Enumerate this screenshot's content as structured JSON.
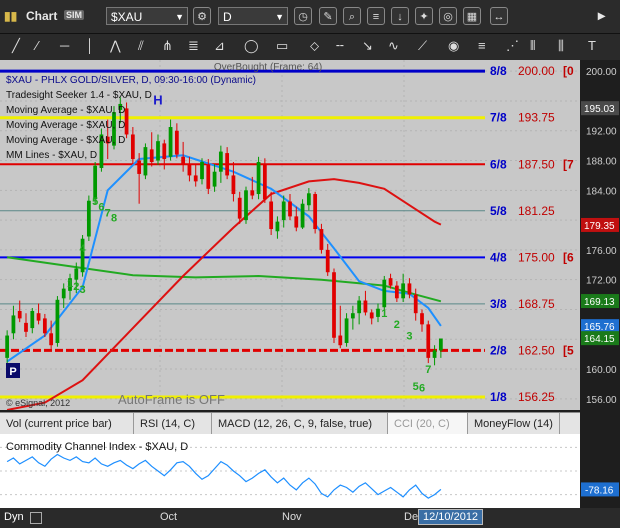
{
  "window": {
    "title": "Chart",
    "title_badge": "SIM",
    "symbol": "$XAU",
    "interval": "D"
  },
  "tabs": [
    {
      "label": "Vol (current price bar)"
    },
    {
      "label": "RSI (14, C)"
    },
    {
      "label": "MACD (12, 26, C, 9, false, true)"
    },
    {
      "label": "CCI (20, C)"
    },
    {
      "label": "MoneyFlow (14)"
    }
  ],
  "statusbar": {
    "left": "Dyn",
    "date_box": "12/10/2012"
  },
  "colors": {
    "background": "#c8c8c8",
    "candle_up": "#009900",
    "candle_down": "#e00000",
    "ma_short": "#1e90ff",
    "ma_long": "#dd1111",
    "ma_green": "#22aa22",
    "mm_8_8": "#0000c8",
    "mm_yellow": "#f0f000",
    "mm_red": "#e00000",
    "mm_teal": "#5a8888",
    "mm_blue": "#0000ee",
    "price_label_bg": "#0a2a6a",
    "last_price_label_bg": "#1a7a1a"
  },
  "chart_data": [
    {
      "type": "candlestick",
      "title": "$XAU - PHLX GOLD/SILVER, D, 09:30-16:00 (Dynamic)",
      "overlay_text": "OverBought (Frame: 64)",
      "legend": [
        "$XAU - PHLX GOLD/SILVER, D, 09:30-16:00 (Dynamic)",
        "Tradesight Seeker 1.4 - $XAU, D",
        "Moving Average - $XAU, D",
        "Moving Average - $XAU, D",
        "Moving Average - $XAU, D",
        "MM Lines - $XAU, D"
      ],
      "x_tick_labels": [
        "Oct",
        "Nov",
        "Dec"
      ],
      "y_range": [
        154.5,
        201.5
      ],
      "y_ticks": [
        156,
        160,
        164,
        168,
        172,
        176,
        180,
        184,
        188,
        192,
        196,
        200
      ],
      "right_price_labels": [
        "200.00",
        "195.03",
        "192.00",
        "188.00",
        "184.00",
        "179.35",
        "176.00",
        "172.00",
        "169.13",
        "165.76",
        "164.15",
        "160.00",
        "156.00"
      ],
      "last_price": 164.15,
      "ohlc": [
        [
          161.5,
          165.2,
          160.8,
          164.5
        ],
        [
          164.8,
          168.5,
          164.0,
          167.2
        ],
        [
          167.8,
          169.2,
          166.3,
          166.8
        ],
        [
          166.2,
          167.5,
          164.3,
          165.0
        ],
        [
          165.5,
          168.2,
          164.8,
          167.8
        ],
        [
          167.5,
          168.8,
          166.0,
          166.5
        ],
        [
          166.8,
          167.4,
          164.3,
          164.8
        ],
        [
          164.8,
          166.5,
          162.7,
          163.2
        ],
        [
          163.5,
          169.8,
          163.0,
          169.3
        ],
        [
          169.5,
          171.5,
          168.2,
          170.8
        ],
        [
          170.5,
          172.8,
          169.3,
          172.2
        ],
        [
          172.0,
          174.3,
          170.2,
          173.5
        ],
        [
          173.0,
          178.0,
          172.4,
          177.5
        ],
        [
          177.8,
          183.3,
          177.2,
          182.6
        ],
        [
          182.8,
          187.8,
          182.1,
          187.3
        ],
        [
          187.0,
          192.3,
          186.5,
          191.5
        ],
        [
          191.2,
          193.5,
          188.2,
          190.3
        ],
        [
          190.0,
          195.3,
          189.5,
          194.5
        ],
        [
          194.8,
          196.5,
          193.0,
          195.6
        ],
        [
          195.0,
          195.8,
          191.0,
          191.5
        ],
        [
          191.5,
          192.5,
          187.5,
          188.2
        ],
        [
          188.0,
          189.0,
          182.2,
          186.2
        ],
        [
          186.0,
          190.3,
          185.5,
          189.8
        ],
        [
          189.5,
          191.8,
          187.2,
          187.8
        ],
        [
          188.0,
          191.5,
          187.4,
          190.6
        ],
        [
          190.3,
          190.8,
          186.8,
          188.2
        ],
        [
          188.5,
          193.5,
          188.0,
          192.5
        ],
        [
          192.0,
          193.0,
          188.3,
          188.8
        ],
        [
          188.5,
          190.5,
          186.5,
          187.5
        ],
        [
          187.5,
          188.5,
          185.2,
          186.0
        ],
        [
          186.0,
          187.5,
          184.5,
          185.2
        ],
        [
          185.5,
          188.3,
          184.8,
          187.8
        ],
        [
          187.5,
          188.2,
          183.5,
          184.2
        ],
        [
          184.5,
          187.5,
          183.8,
          186.5
        ],
        [
          186.5,
          190.0,
          185.0,
          189.2
        ],
        [
          189.0,
          189.8,
          185.5,
          186.0
        ],
        [
          186.0,
          187.8,
          182.5,
          183.5
        ],
        [
          183.0,
          183.8,
          179.5,
          180.2
        ],
        [
          180.0,
          184.5,
          179.5,
          184.0
        ],
        [
          184.0,
          185.8,
          182.8,
          183.3
        ],
        [
          183.5,
          188.5,
          182.8,
          187.8
        ],
        [
          187.5,
          188.3,
          182.3,
          182.8
        ],
        [
          182.5,
          183.8,
          178.0,
          178.8
        ],
        [
          178.5,
          180.5,
          177.5,
          179.8
        ],
        [
          180.0,
          183.3,
          179.0,
          182.5
        ],
        [
          182.5,
          183.5,
          180.0,
          180.5
        ],
        [
          180.5,
          181.8,
          178.5,
          179.0
        ],
        [
          179.0,
          182.8,
          178.8,
          182.2
        ],
        [
          182.0,
          184.3,
          181.3,
          183.6
        ],
        [
          183.5,
          183.8,
          178.2,
          178.8
        ],
        [
          178.8,
          179.5,
          175.5,
          176.0
        ],
        [
          176.0,
          176.8,
          172.5,
          173.0
        ],
        [
          173.0,
          173.5,
          163.5,
          164.2
        ],
        [
          164.5,
          168.5,
          162.8,
          163.2
        ],
        [
          163.5,
          167.5,
          163.0,
          166.8
        ],
        [
          166.8,
          168.5,
          165.3,
          167.5
        ],
        [
          167.5,
          169.8,
          166.0,
          169.2
        ],
        [
          169.2,
          170.5,
          167.2,
          167.6
        ],
        [
          167.6,
          168.0,
          166.0,
          166.8
        ],
        [
          167.0,
          168.8,
          166.3,
          168.1
        ],
        [
          168.3,
          172.5,
          167.8,
          172.0
        ],
        [
          172.2,
          172.8,
          170.8,
          171.2
        ],
        [
          171.2,
          171.8,
          169.0,
          169.5
        ],
        [
          169.5,
          172.8,
          169.0,
          171.5
        ],
        [
          171.5,
          172.2,
          169.5,
          170.0
        ],
        [
          170.0,
          170.8,
          166.5,
          167.5
        ],
        [
          167.5,
          168.0,
          165.0,
          166.0
        ],
        [
          166.0,
          166.5,
          160.8,
          161.5
        ],
        [
          161.5,
          163.2,
          160.5,
          162.5
        ],
        [
          162.5,
          164.0,
          161.5,
          164.1
        ]
      ],
      "moving_average_blue": [
        [
          0,
          161.0
        ],
        [
          6,
          164.5
        ],
        [
          12,
          171.0
        ],
        [
          16,
          184.0
        ],
        [
          21,
          188.2
        ],
        [
          28,
          188.7
        ],
        [
          36,
          186.5
        ],
        [
          42,
          184.2
        ],
        [
          48,
          180.5
        ],
        [
          52,
          176.2
        ],
        [
          56,
          171.8
        ],
        [
          60,
          170.5
        ],
        [
          64,
          170.1
        ],
        [
          67,
          168.2
        ],
        [
          69,
          165.8
        ]
      ],
      "moving_average_red": [
        [
          0,
          154.5
        ],
        [
          6,
          155.5
        ],
        [
          12,
          158.5
        ],
        [
          20,
          165.5
        ],
        [
          28,
          172.5
        ],
        [
          36,
          179.0
        ],
        [
          42,
          183.5
        ],
        [
          48,
          185.2
        ],
        [
          52,
          185.5
        ],
        [
          56,
          185.0
        ],
        [
          60,
          184.2
        ],
        [
          64,
          182.0
        ],
        [
          68,
          179.8
        ],
        [
          69,
          179.4
        ]
      ],
      "moving_average_green": [
        [
          0,
          175.0
        ],
        [
          10,
          173.8
        ],
        [
          20,
          172.6
        ],
        [
          30,
          172.3
        ],
        [
          40,
          172.5
        ],
        [
          50,
          172.0
        ],
        [
          60,
          171.2
        ],
        [
          65,
          170.0
        ],
        [
          69,
          169.1
        ]
      ],
      "mm_lines": [
        {
          "label": "8/8",
          "price": "200.00",
          "tag": "0",
          "value": 200.0,
          "color": "#0000c8",
          "dash": false,
          "width": 3
        },
        {
          "label": "7/8",
          "price": "193.75",
          "tag": "",
          "value": 193.75,
          "color": "#f0f000",
          "dash": false,
          "width": 3
        },
        {
          "label": "6/8",
          "price": "187.50",
          "tag": "7",
          "value": 187.5,
          "color": "#e00000",
          "dash": false,
          "width": 2
        },
        {
          "label": "5/8",
          "price": "181.25",
          "tag": "",
          "value": 181.25,
          "color": "#5a8888",
          "dash": false,
          "width": 1
        },
        {
          "label": "4/8",
          "price": "175.00",
          "tag": "6",
          "value": 175.0,
          "color": "#0000ee",
          "dash": false,
          "width": 2
        },
        {
          "label": "3/8",
          "price": "168.75",
          "tag": "",
          "value": 168.75,
          "color": "#5a8888",
          "dash": false,
          "width": 1
        },
        {
          "label": "2/8",
          "price": "162.50",
          "tag": "5",
          "value": 162.5,
          "color": "#e00000",
          "dash": true,
          "width": 3
        },
        {
          "label": "1/8",
          "price": "156.25",
          "tag": "",
          "value": 156.25,
          "color": "#f0f000",
          "dash": false,
          "width": 3
        }
      ],
      "annotations": [
        {
          "text": "5",
          "bar": 14,
          "price": 182.0,
          "color": "#22aa22"
        },
        {
          "text": "6",
          "bar": 15,
          "price": 181.3,
          "color": "#22aa22"
        },
        {
          "text": "7",
          "bar": 16,
          "price": 180.5,
          "color": "#22aa22"
        },
        {
          "text": "8",
          "bar": 17,
          "price": 179.8,
          "color": "#22aa22"
        },
        {
          "text": "4",
          "bar": 12,
          "price": 175.7,
          "color": "#22aa22"
        },
        {
          "text": "1",
          "bar": 10,
          "price": 171.0,
          "color": "#22aa22"
        },
        {
          "text": "2",
          "bar": 11,
          "price": 170.6,
          "color": "#22aa22"
        },
        {
          "text": "3",
          "bar": 12,
          "price": 170.2,
          "color": "#22aa22"
        },
        {
          "text": "H",
          "bar": 24,
          "price": 195.5,
          "color": "#1a1acc"
        },
        {
          "text": "1",
          "bar": 60,
          "price": 167.0,
          "color": "#22aa22"
        },
        {
          "text": "2",
          "bar": 62,
          "price": 165.5,
          "color": "#22aa22"
        },
        {
          "text": "3",
          "bar": 64,
          "price": 164.0,
          "color": "#22aa22"
        },
        {
          "text": "7",
          "bar": 67,
          "price": 159.5,
          "color": "#22aa22"
        },
        {
          "text": "5",
          "bar": 65,
          "price": 157.2,
          "color": "#22aa22"
        },
        {
          "text": "6",
          "bar": 66,
          "price": 157.0,
          "color": "#22aa22"
        }
      ],
      "marker_p": "P",
      "watermark": "AutoFrame is OFF",
      "source": "© eSignal, 2012"
    },
    {
      "type": "line",
      "title": "Commodity Channel Index - $XAU, D",
      "y_range": [
        -140,
        140
      ],
      "y_ticks": [
        -100,
        0,
        100
      ],
      "last_value_label": "-78.16",
      "last_value": -78.16,
      "values": [
        40,
        55,
        30,
        45,
        60,
        35,
        20,
        50,
        70,
        55,
        45,
        60,
        40,
        35,
        55,
        30,
        20,
        35,
        45,
        25,
        10,
        30,
        45,
        20,
        0,
        -20,
        5,
        35,
        40,
        20,
        -10,
        -35,
        -20,
        10,
        40,
        25,
        0,
        -20,
        -45,
        -30,
        -10,
        5,
        -25,
        -50,
        -30,
        -60,
        -80,
        -50,
        -30,
        -55,
        -95,
        -110,
        -80,
        -60,
        -70,
        -90,
        -65,
        -50,
        -75,
        -100,
        -85,
        -70,
        -90,
        -110,
        -80,
        -60,
        -95,
        -115,
        -100,
        -78.16
      ]
    }
  ]
}
